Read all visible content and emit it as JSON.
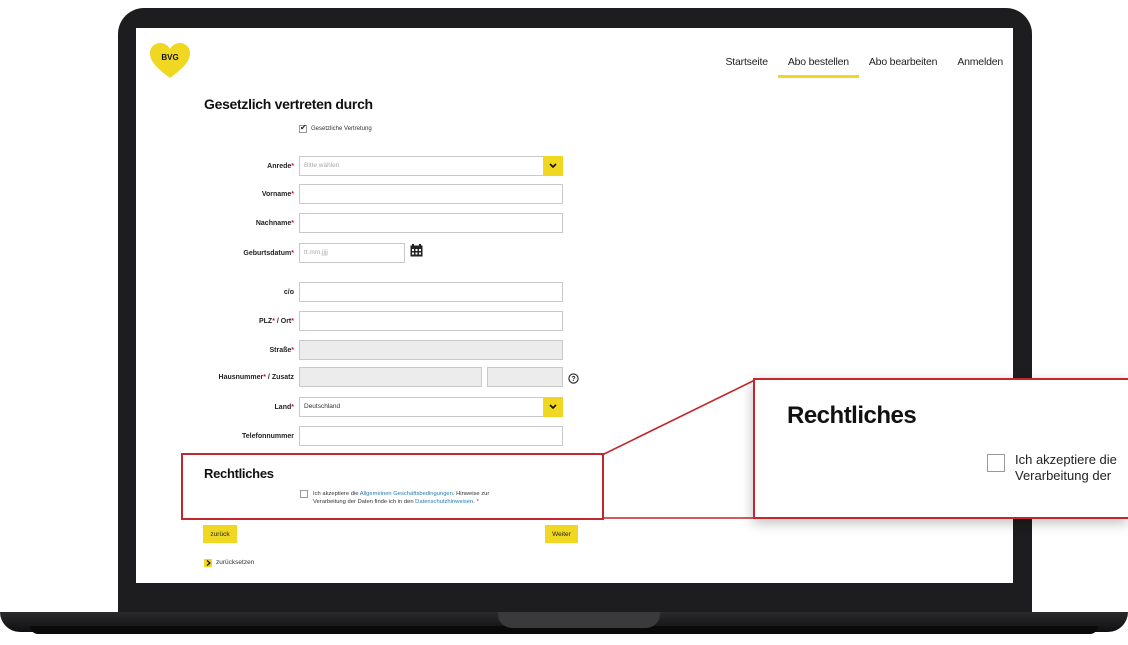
{
  "header": {
    "logo_text": "BVG",
    "nav": [
      {
        "label": "Startseite"
      },
      {
        "label": "Abo bestellen",
        "active": true
      },
      {
        "label": "Abo bearbeiten"
      },
      {
        "label": "Anmelden"
      }
    ]
  },
  "representation": {
    "title": "Gesetzlich vertreten durch",
    "checkbox_label": "Gesetzliche Vertretung",
    "checked": true
  },
  "form": {
    "anrede": {
      "label": "Anrede",
      "placeholder": "Bitte wählen"
    },
    "vorname": {
      "label": "Vorname",
      "value": ""
    },
    "nachname": {
      "label": "Nachname",
      "value": ""
    },
    "geburtsdatum": {
      "label": "Geburtsdatum",
      "placeholder": "tt.mm.jjjj"
    },
    "co": {
      "label": "c/o",
      "value": ""
    },
    "plz_ort": {
      "label_plz": "PLZ",
      "label_ort": " / Ort",
      "value": ""
    },
    "strasse": {
      "label": "Straße",
      "value": ""
    },
    "hausnummer": {
      "label_nr": "Hausnummer",
      "label_zusatz": " / Zusatz"
    },
    "land": {
      "label": "Land",
      "value": "Deutschland"
    },
    "telefon": {
      "label": "Telefonnummer",
      "value": ""
    }
  },
  "legal": {
    "title": "Rechtliches",
    "text_1": "Ich akzeptiere die ",
    "link_agb": "Allgemeinen Geschäftsbedingungen",
    "text_2": ". Hinweise zur",
    "text_3": "Verarbeitung der Daten finde ich in den ",
    "link_privacy": "Datenschutzhinweisen",
    "text_4": ".",
    "required_mark": "*"
  },
  "actions": {
    "back": "zurück",
    "next": "Weiter",
    "reset": "zurücksetzen"
  },
  "zoom": {
    "title": "Rechtliches",
    "line1": "Ich akzeptiere die",
    "line2": "Verarbeitung der"
  },
  "colors": {
    "accent": "#f0d722",
    "highlight": "#c1272d",
    "required": "#d3132b",
    "link": "#2a7ab0"
  },
  "required_mark": "*"
}
